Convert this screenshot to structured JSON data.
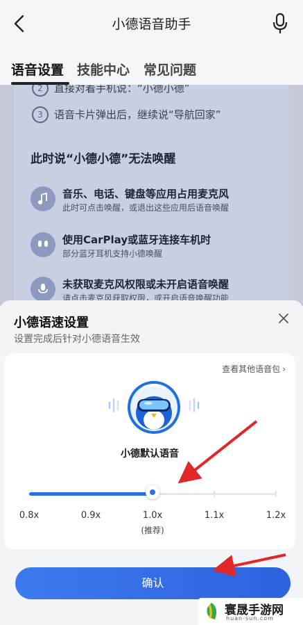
{
  "nav": {
    "title": "小德语音助手",
    "back_icon": "chevron-left-icon",
    "mic_icon": "microphone-icon"
  },
  "tabs": [
    {
      "label": "语音设置",
      "active": true
    },
    {
      "label": "技能中心",
      "active": false
    },
    {
      "label": "常见问题",
      "active": false
    }
  ],
  "guide": {
    "steps": [
      {
        "num": "2",
        "text": "直接对着手机说：“小德小德”"
      },
      {
        "num": "3",
        "text": "语音卡片弹出后，继续说“导航回家”"
      }
    ],
    "heading": "此时说“小德小德”无法唤醒",
    "reasons": [
      {
        "icon": "music-note-icon",
        "title": "音乐、电话、键盘等应用占用麦克风",
        "sub": "此时可点击唤醒，或退出这些应用后语音唤醒"
      },
      {
        "icon": "earbuds-icon",
        "title": "使用CarPlay或蓝牙连接车机时",
        "sub": "部分蓝牙耳机支持小德唤醒"
      },
      {
        "icon": "microphone-icon",
        "title": "未获取麦克风权限或未开启语音唤醒",
        "sub": "请点击麦克风获取权限，或开启语音唤醒功能"
      }
    ]
  },
  "sheet": {
    "title": "小德语速设置",
    "subtitle": "设置完成后针对小德语音生效",
    "close_icon": "close-icon",
    "more_voices": "查看其他语音包",
    "voice_name": "小德默认语音",
    "speeds": [
      "0.8x",
      "0.9x",
      "1.0x",
      "1.1x",
      "1.2x"
    ],
    "selected_speed": "1.0x",
    "recommended_label": "(推荐)",
    "confirm": "确认"
  },
  "watermark": {
    "text": "寰晟手游网",
    "url": "huan-sun.com"
  },
  "colors": {
    "accent": "#2f6ee8",
    "arrow": "#e02828",
    "background": "#eef1f8"
  }
}
